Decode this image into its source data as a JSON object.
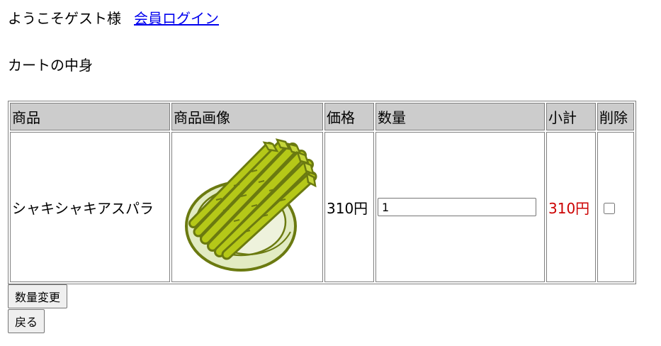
{
  "header": {
    "greeting": "ようこそゲスト様",
    "login_link": "会員ログイン"
  },
  "cart": {
    "heading": "カートの中身",
    "columns": [
      "商品",
      "商品画像",
      "価格",
      "数量",
      "小計",
      "削除"
    ],
    "items": [
      {
        "name": "シャキシャキアスパラ",
        "image": "asparagus-bundle-illustration",
        "price": "310円",
        "quantity": "1",
        "subtotal": "310円",
        "delete_checked": false
      }
    ]
  },
  "buttons": {
    "update_quantity": "数量変更",
    "back": "戻る"
  },
  "colors": {
    "link": "#0000ee",
    "subtotal": "#cc0000",
    "table_header_bg": "#cccccc",
    "asparagus_fill": "#b5c818",
    "asparagus_outline": "#6b7a10",
    "bowl_fill": "#e2ebc2"
  }
}
